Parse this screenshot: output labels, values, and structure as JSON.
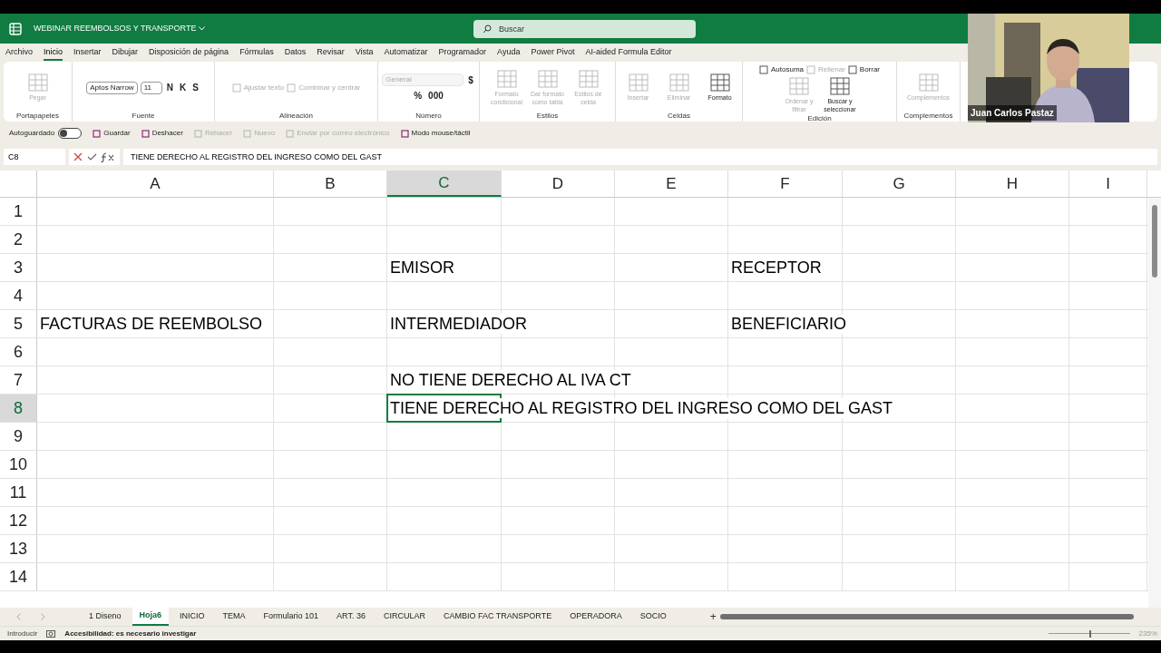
{
  "title_bar": {
    "title": "WEBINAR REEMBOLSOS Y TRANSPORTE",
    "search_placeholder": "Buscar"
  },
  "menu": [
    {
      "label": "Archivo",
      "selected": false
    },
    {
      "label": "Inicio",
      "selected": true
    },
    {
      "label": "Insertar",
      "selected": false
    },
    {
      "label": "Dibujar",
      "selected": false
    },
    {
      "label": "Disposición de página",
      "selected": false
    },
    {
      "label": "Fórmulas",
      "selected": false
    },
    {
      "label": "Datos",
      "selected": false
    },
    {
      "label": "Revisar",
      "selected": false
    },
    {
      "label": "Vista",
      "selected": false
    },
    {
      "label": "Automatizar",
      "selected": false
    },
    {
      "label": "Programador",
      "selected": false
    },
    {
      "label": "Ayuda",
      "selected": false
    },
    {
      "label": "Power Pivot",
      "selected": false
    },
    {
      "label": "AI-aided Formula Editor",
      "selected": false
    }
  ],
  "ribbon": [
    {
      "name": "Portapapeles",
      "items": [
        {
          "kind": "large",
          "label": "Pegar",
          "disabled": true
        }
      ]
    },
    {
      "name": "Fuente",
      "items": [
        {
          "kind": "field",
          "label": "Aptos Narrow",
          "disabled": false
        },
        {
          "kind": "field",
          "label": "11",
          "disabled": false
        },
        {
          "kind": "glyph",
          "label": "N",
          "disabled": false
        },
        {
          "kind": "glyph",
          "label": "K",
          "disabled": false
        },
        {
          "kind": "glyph",
          "label": "S",
          "disabled": false
        }
      ]
    },
    {
      "name": "Alineación",
      "items": [
        {
          "kind": "small",
          "label": "Ajustar texto",
          "disabled": true
        },
        {
          "kind": "small",
          "label": "Combinar y centrar",
          "disabled": true
        }
      ]
    },
    {
      "name": "Número",
      "items": [
        {
          "kind": "field",
          "label": "General",
          "disabled": true
        },
        {
          "kind": "glyph",
          "label": "$",
          "disabled": false
        },
        {
          "kind": "glyph",
          "label": "%",
          "disabled": false
        },
        {
          "kind": "glyph",
          "label": "000",
          "disabled": false
        }
      ]
    },
    {
      "name": "Estilos",
      "items": [
        {
          "kind": "large",
          "label": "Formato condicional",
          "disabled": true
        },
        {
          "kind": "large",
          "label": "Dar formato como tabla",
          "disabled": true
        },
        {
          "kind": "large",
          "label": "Estilos de celda",
          "disabled": true
        }
      ]
    },
    {
      "name": "Celdas",
      "items": [
        {
          "kind": "large",
          "label": "Insertar",
          "disabled": true
        },
        {
          "kind": "large",
          "label": "Eliminar",
          "disabled": true
        },
        {
          "kind": "large",
          "label": "Formato",
          "disabled": false
        }
      ]
    },
    {
      "name": "Edición",
      "items": [
        {
          "kind": "small",
          "label": "Autosuma",
          "disabled": false
        },
        {
          "kind": "small",
          "label": "Rellenar",
          "disabled": true
        },
        {
          "kind": "small",
          "label": "Borrar",
          "disabled": false
        },
        {
          "kind": "large",
          "label": "Ordenar y filtrar",
          "disabled": true
        },
        {
          "kind": "large",
          "label": "Buscar y seleccionar",
          "disabled": false
        }
      ]
    },
    {
      "name": "Complementos",
      "items": [
        {
          "kind": "large",
          "label": "Complementos",
          "disabled": true
        }
      ]
    }
  ],
  "quick_access": {
    "autosave_label": "Autoguardado",
    "autosave_on": false,
    "items": [
      {
        "label": "Guardar",
        "disabled": false
      },
      {
        "label": "Deshacer",
        "disabled": false
      },
      {
        "label": "Rehacer",
        "disabled": true
      },
      {
        "label": "Nuevo",
        "disabled": true
      },
      {
        "label": "Enviar por correo electrónico",
        "disabled": true
      },
      {
        "label": "Modo mouse/táctil",
        "disabled": false
      }
    ]
  },
  "formula_bar": {
    "name_box": "C8",
    "formula": "TIENE DERECHO AL REGISTRO DEL INGRESO COMO DEL GAST"
  },
  "columns": [
    {
      "label": "A",
      "selected": false
    },
    {
      "label": "B",
      "selected": false
    },
    {
      "label": "C",
      "selected": true
    },
    {
      "label": "D",
      "selected": false
    },
    {
      "label": "E",
      "selected": false
    },
    {
      "label": "F",
      "selected": false
    },
    {
      "label": "G",
      "selected": false
    },
    {
      "label": "H",
      "selected": false
    },
    {
      "label": "I",
      "selected": false
    }
  ],
  "rows": [
    {
      "label": "1",
      "selected": false,
      "cells": {}
    },
    {
      "label": "2",
      "selected": false,
      "cells": {}
    },
    {
      "label": "3",
      "selected": false,
      "cells": {
        "C": "EMISOR",
        "F": "RECEPTOR"
      }
    },
    {
      "label": "4",
      "selected": false,
      "cells": {}
    },
    {
      "label": "5",
      "selected": false,
      "cells": {
        "A": "FACTURAS DE REEMBOLSO",
        "C": "INTERMEDIADOR",
        "F": "BENEFICIARIO"
      }
    },
    {
      "label": "6",
      "selected": false,
      "cells": {}
    },
    {
      "label": "7",
      "selected": false,
      "cells": {
        "C": "NO TIENE DERECHO AL IVA CT"
      }
    },
    {
      "label": "8",
      "selected": true,
      "cells": {
        "C": "TIENE DERECHO AL REGISTRO DEL INGRESO COMO DEL GAST"
      }
    },
    {
      "label": "9",
      "selected": false,
      "cells": {}
    },
    {
      "label": "10",
      "selected": false,
      "cells": {}
    },
    {
      "label": "11",
      "selected": false,
      "cells": {}
    },
    {
      "label": "12",
      "selected": false,
      "cells": {}
    },
    {
      "label": "13",
      "selected": false,
      "cells": {}
    },
    {
      "label": "14",
      "selected": false,
      "cells": {}
    }
  ],
  "sheet_tabs": [
    {
      "label": "1 Diseno",
      "selected": false
    },
    {
      "label": "Hoja6",
      "selected": true
    },
    {
      "label": "INICIO",
      "selected": false
    },
    {
      "label": "TEMA",
      "selected": false
    },
    {
      "label": "Formulario 101",
      "selected": false
    },
    {
      "label": "ART. 36",
      "selected": false
    },
    {
      "label": "CIRCULAR",
      "selected": false
    },
    {
      "label": "CAMBIO FAC TRANSPORTE",
      "selected": false
    },
    {
      "label": "OPERADORA",
      "selected": false
    },
    {
      "label": "SOCIO",
      "selected": false
    }
  ],
  "add_sheet": "+",
  "status_bar": {
    "mode": "Introducir",
    "accessibility": "Accesibilidad: es necesario investigar",
    "zoom": "235%",
    "zoom_slider": {
      "level": 0.5
    }
  },
  "webcam": {
    "label": "Juan Carlos Pastaz"
  }
}
